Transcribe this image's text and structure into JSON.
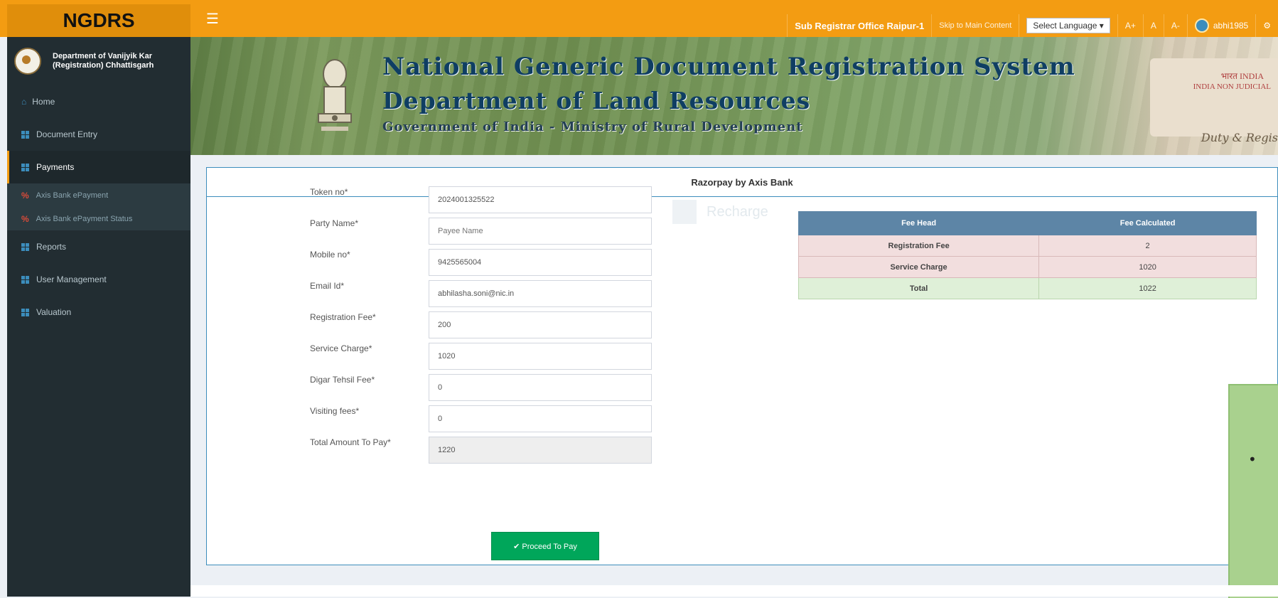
{
  "brand": "NGDRS",
  "topnav": {
    "office": "Sub Registrar Office Raipur-1",
    "skip": "Skip to Main Content",
    "language": "Select Language ▾",
    "font_large": "A+",
    "font_normal": "A",
    "font_small": "A-",
    "user": "abhi1985"
  },
  "sidebar": {
    "department": "Department of Vanijyik Kar (Registration) Chhattisgarh",
    "items": [
      {
        "label": "Home"
      },
      {
        "label": "Document Entry"
      },
      {
        "label": "Payments"
      },
      {
        "label": "Axis Bank ePayment"
      },
      {
        "label": "Axis Bank ePayment Status"
      },
      {
        "label": "Reports"
      },
      {
        "label": "User Management"
      },
      {
        "label": "Valuation"
      }
    ]
  },
  "banner": {
    "title": "National Generic Document Registration System",
    "subtitle": "Department of Land Resources",
    "ministry": "Government of India - Ministry of Rural Development",
    "stamp_top": "भारत INDIA",
    "stamp_mid": "INDIA NON JUDICIAL",
    "stamp_bottom": "Duty & Regis"
  },
  "panel": {
    "title": "Razorpay by Axis Bank",
    "ghost_button": "Recharge",
    "fields": [
      {
        "label": "Token no*",
        "value": "2024001325522",
        "placeholder": ""
      },
      {
        "label": "Party Name*",
        "value": "",
        "placeholder": "Payee Name"
      },
      {
        "label": "Mobile no*",
        "value": "9425565004",
        "placeholder": ""
      },
      {
        "label": "Email Id*",
        "value": "abhilasha.soni@nic.in",
        "placeholder": ""
      },
      {
        "label": "Registration Fee*",
        "value": "200",
        "placeholder": ""
      },
      {
        "label": "Service Charge*",
        "value": "1020",
        "placeholder": ""
      },
      {
        "label": "Digar Tehsil Fee*",
        "value": "0",
        "placeholder": ""
      },
      {
        "label": "Visiting fees*",
        "value": "0",
        "placeholder": ""
      },
      {
        "label": "Total Amount To Pay*",
        "value": "1220",
        "placeholder": ""
      }
    ],
    "proceed_label": "✔ Proceed To Pay",
    "fee_table": {
      "headers": [
        "Fee Head",
        "Fee Calculated"
      ],
      "rows": [
        {
          "head": "Registration Fee",
          "value": "2"
        },
        {
          "head": "Service Charge",
          "value": "1020"
        },
        {
          "head": "Total",
          "value": "1022"
        }
      ]
    }
  },
  "side_widget_bullet": "•"
}
